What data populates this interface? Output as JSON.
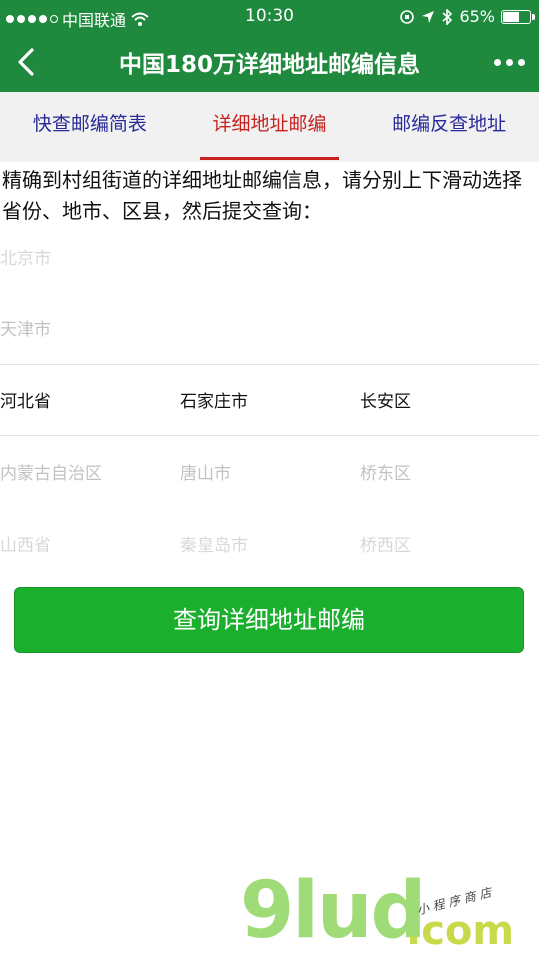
{
  "status_bar": {
    "carrier": "中国联通",
    "time": "10:30",
    "battery_percent": "65%",
    "battery_level": 0.65
  },
  "navbar": {
    "title": "中国180万详细地址邮编信息"
  },
  "tabs": [
    {
      "label": "快查邮编简表",
      "active": false
    },
    {
      "label": "详细地址邮编",
      "active": true
    },
    {
      "label": "邮编反查地址",
      "active": false
    }
  ],
  "description": "精确到村组街道的详细地址邮编信息，请分别上下滑动选择省份、地市、区县，然后提交查询：",
  "picker": {
    "rows": [
      {
        "province": "北京市",
        "city": "",
        "district": ""
      },
      {
        "province": "天津市",
        "city": "",
        "district": ""
      },
      {
        "province": "河北省",
        "city": "石家庄市",
        "district": "长安区"
      },
      {
        "province": "内蒙古自治区",
        "city": "唐山市",
        "district": "桥东区"
      },
      {
        "province": "山西省",
        "city": "秦皇岛市",
        "district": "桥西区"
      }
    ],
    "selected_index": 2
  },
  "submit_button": "查询详细地址邮编",
  "watermark": {
    "brand": "9lud",
    "domain": ".com",
    "tagline": "小程序商店"
  },
  "colors": {
    "brand_green": "#1f8a3e",
    "button_green": "#1ab02d",
    "active_tab_red": "#c7221f",
    "tab_blue": "#2a2a99"
  }
}
